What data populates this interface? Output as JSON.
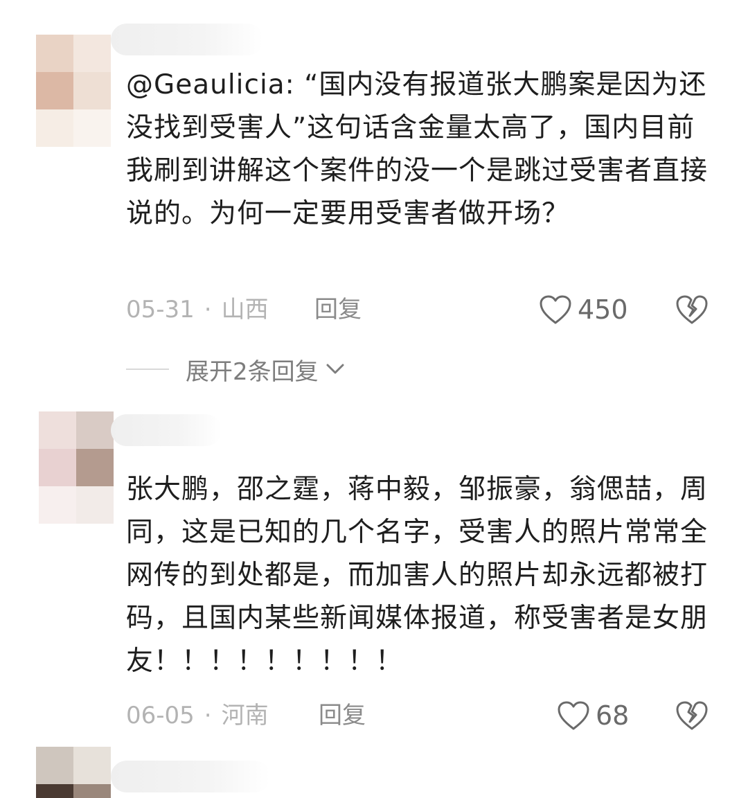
{
  "comments": [
    {
      "text": "@Geaulicia: “国内没有报道张大鹏案是因为还没找到受害人”这句话含金量太高了，国内目前我刷到讲解这个案件的没一个是跳过受害者直接说的。为何一定要用受害者做开场？",
      "date": "05-31",
      "location": "山西",
      "reply_label": "回复",
      "likes": "450",
      "expand_label": "展开2条回复"
    },
    {
      "text": "张大鹏，邵之霆，蒋中毅，邹振豪，翁偲喆，周同，这是已知的几个名字，受害人的照片常常全网传的到处都是，而加害人的照片却永远都被打码，且国内某些新闻媒体报道，称受害者是女朋友！！！！！！！！！",
      "date": "06-05",
      "location": "河南",
      "reply_label": "回复",
      "likes": "68"
    }
  ],
  "colors": {
    "text": "#1e1e1e",
    "meta": "#b3b3b3",
    "reply": "#8a8a8a",
    "icon": "#6a6a6a"
  },
  "icons": [
    "heart-outline-icon",
    "broken-heart-icon",
    "chevron-down-icon"
  ]
}
